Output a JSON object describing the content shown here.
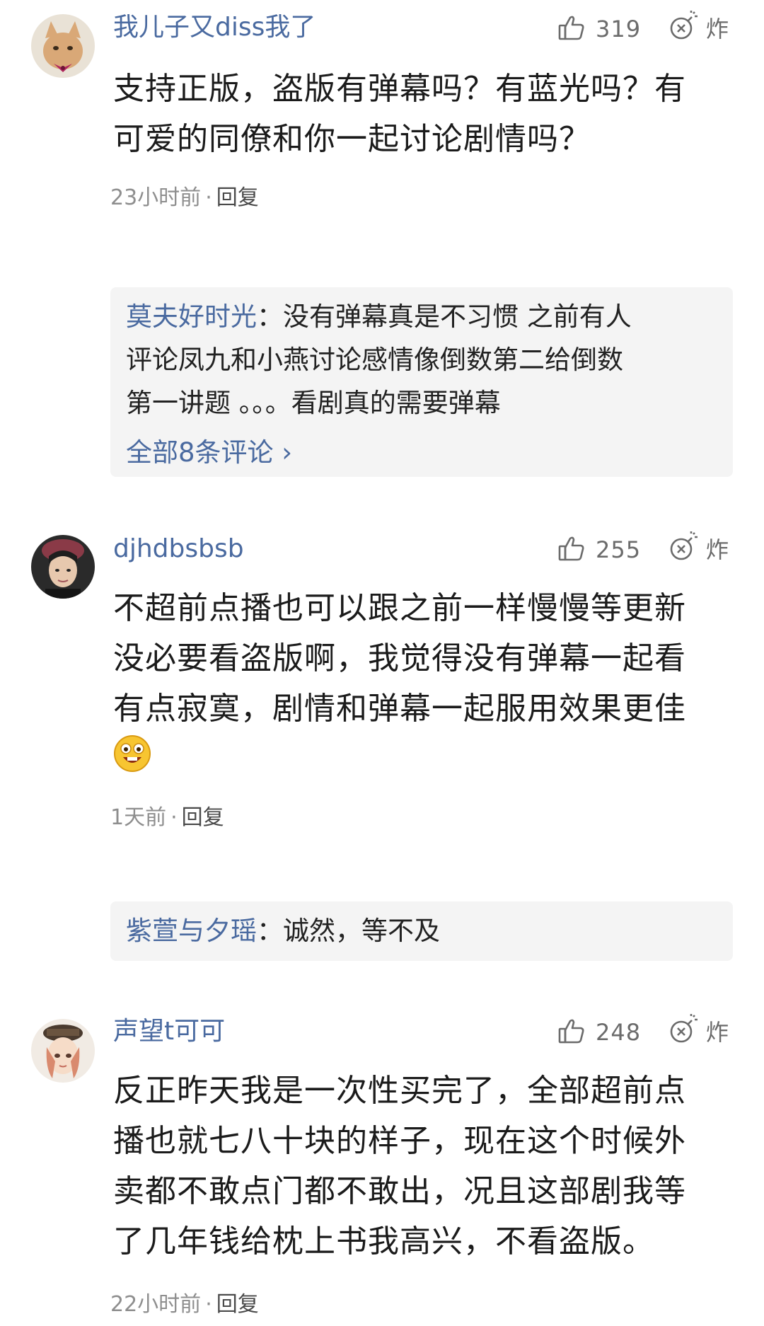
{
  "comments": [
    {
      "username": "我儿子又diss我了",
      "likes": "319",
      "bomb_label": "炸",
      "text_lines": [
        "支持正版，盗版有弹幕吗？有蓝光吗？有",
        "可爱的同僚和你一起讨论剧情吗？"
      ],
      "time": "23小时前",
      "reply_label": "回复",
      "reply": {
        "author": "莫夫好时光",
        "separator": "：",
        "text_lines": [
          "没有弹幕真是不习惯 之前有人",
          "评论凤九和小燕讨论感情像倒数第二给倒数",
          "第一讲题 。。。看剧真的需要弹幕"
        ],
        "view_all": "全部8条评论 ›"
      }
    },
    {
      "username": "djhdbsbsb",
      "likes": "255",
      "bomb_label": "炸",
      "text_lines": [
        "不超前点播也可以跟之前一样慢慢等更新",
        "没必要看盗版啊，我觉得没有弹幕一起看",
        "有点寂寞，剧情和弹幕一起服用效果更佳"
      ],
      "emoji": "grinning-face-emoji",
      "time": "1天前",
      "reply_label": "回复",
      "reply": {
        "author": "紫萱与夕瑶",
        "separator": "：",
        "text": "诚然，等不及"
      }
    },
    {
      "username": "声望t可可",
      "likes": "248",
      "bomb_label": "炸",
      "text_lines": [
        "反正昨天我是一次性买完了，全部超前点",
        "播也就七八十块的样子，现在这个时候外",
        "卖都不敢点门都不敢出，况且这部剧我等",
        "了几年钱给枕上书我高兴，不看盗版。"
      ],
      "time": "22小时前",
      "reply_label": "回复"
    }
  ],
  "colors": {
    "username": "#4a6aa0",
    "text": "#1b1b1b",
    "meta": "#8e8e8e",
    "reply_bg": "#f4f4f4"
  },
  "icons": [
    "thumbs-up-icon",
    "bomb-icon"
  ]
}
